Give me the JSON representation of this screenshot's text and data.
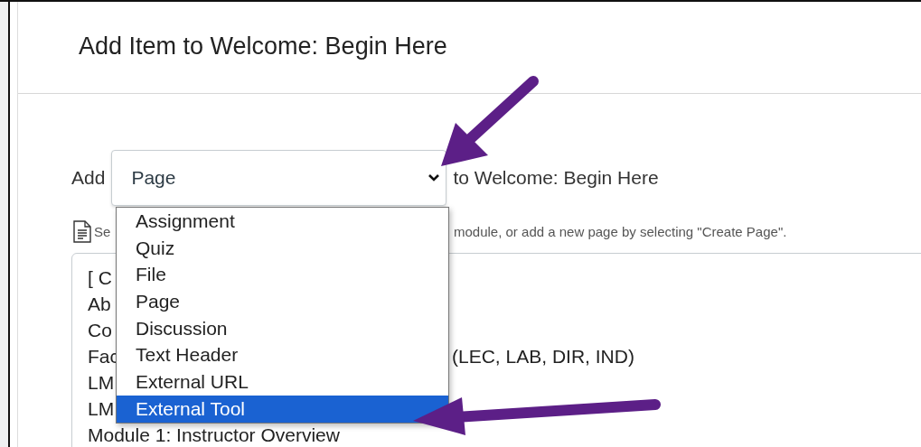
{
  "dialog": {
    "title": "Add Item to Welcome: Begin Here"
  },
  "add_row": {
    "label": "Add",
    "select": {
      "value": "Page",
      "expanded": true
    },
    "target": "to Welcome: Begin Here"
  },
  "hint": {
    "visible_start": "Se",
    "visible_end": "module, or add a new page by selecting \"Create Page\"."
  },
  "dropdown_options": [
    {
      "label": "Assignment",
      "selected": false
    },
    {
      "label": "Quiz",
      "selected": false
    },
    {
      "label": "File",
      "selected": false
    },
    {
      "label": "Page",
      "selected": false
    },
    {
      "label": "Discussion",
      "selected": false
    },
    {
      "label": "Text Header",
      "selected": false
    },
    {
      "label": "External URL",
      "selected": false
    },
    {
      "label": "External Tool",
      "selected": true
    }
  ],
  "page_list": [
    {
      "visible_start": "[ C"
    },
    {
      "visible_start": "Ab"
    },
    {
      "visible_start": "Co"
    },
    {
      "visible_start": "Fac",
      "visible_end": "(LEC, LAB, DIR, IND)"
    },
    {
      "visible_start": "LM"
    },
    {
      "visible_start": "LM"
    },
    {
      "visible_start": "Module 1: Instructor Overview"
    }
  ]
}
